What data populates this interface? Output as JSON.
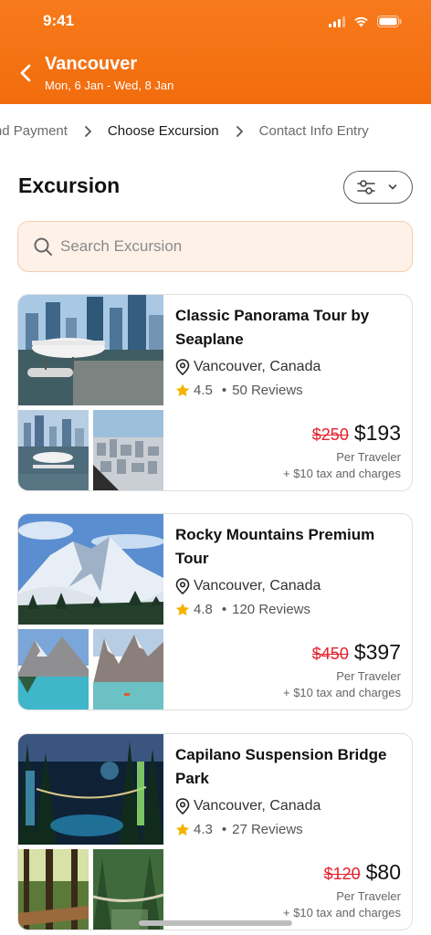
{
  "status_bar": {
    "time": "9:41"
  },
  "header": {
    "title": "Vancouver",
    "dates": "Mon, 6 Jan - Wed, 8 Jan"
  },
  "steps": [
    {
      "label": "Rental and Payment"
    },
    {
      "label": "Choose Excursion",
      "active": true
    },
    {
      "label": "Contact Info Entry"
    }
  ],
  "section": {
    "title": "Excursion"
  },
  "search": {
    "placeholder": "Search Excursion"
  },
  "colors": {
    "accent": "#f26c0c",
    "strike": "#e3202c",
    "star": "#f5b301"
  },
  "excursions": [
    {
      "title": "Classic Panorama Tour by Seaplane",
      "location": "Vancouver, Canada",
      "rating": "4.5",
      "reviews": "50 Reviews",
      "old_price": "$250",
      "price": "$193",
      "per": "Per Traveler",
      "tax": "+ $10 tax and charges"
    },
    {
      "title": "Rocky Mountains Premium Tour",
      "location": "Vancouver, Canada",
      "rating": "4.8",
      "reviews": "120 Reviews",
      "old_price": "$450",
      "price": "$397",
      "per": "Per Traveler",
      "tax": "+ $10 tax and charges"
    },
    {
      "title": "Capilano Suspension Bridge Park",
      "location": "Vancouver, Canada",
      "rating": "4.3",
      "reviews": "27 Reviews",
      "old_price": "$120",
      "price": "$80",
      "per": "Per Traveler",
      "tax": "+ $10 tax and charges"
    }
  ]
}
